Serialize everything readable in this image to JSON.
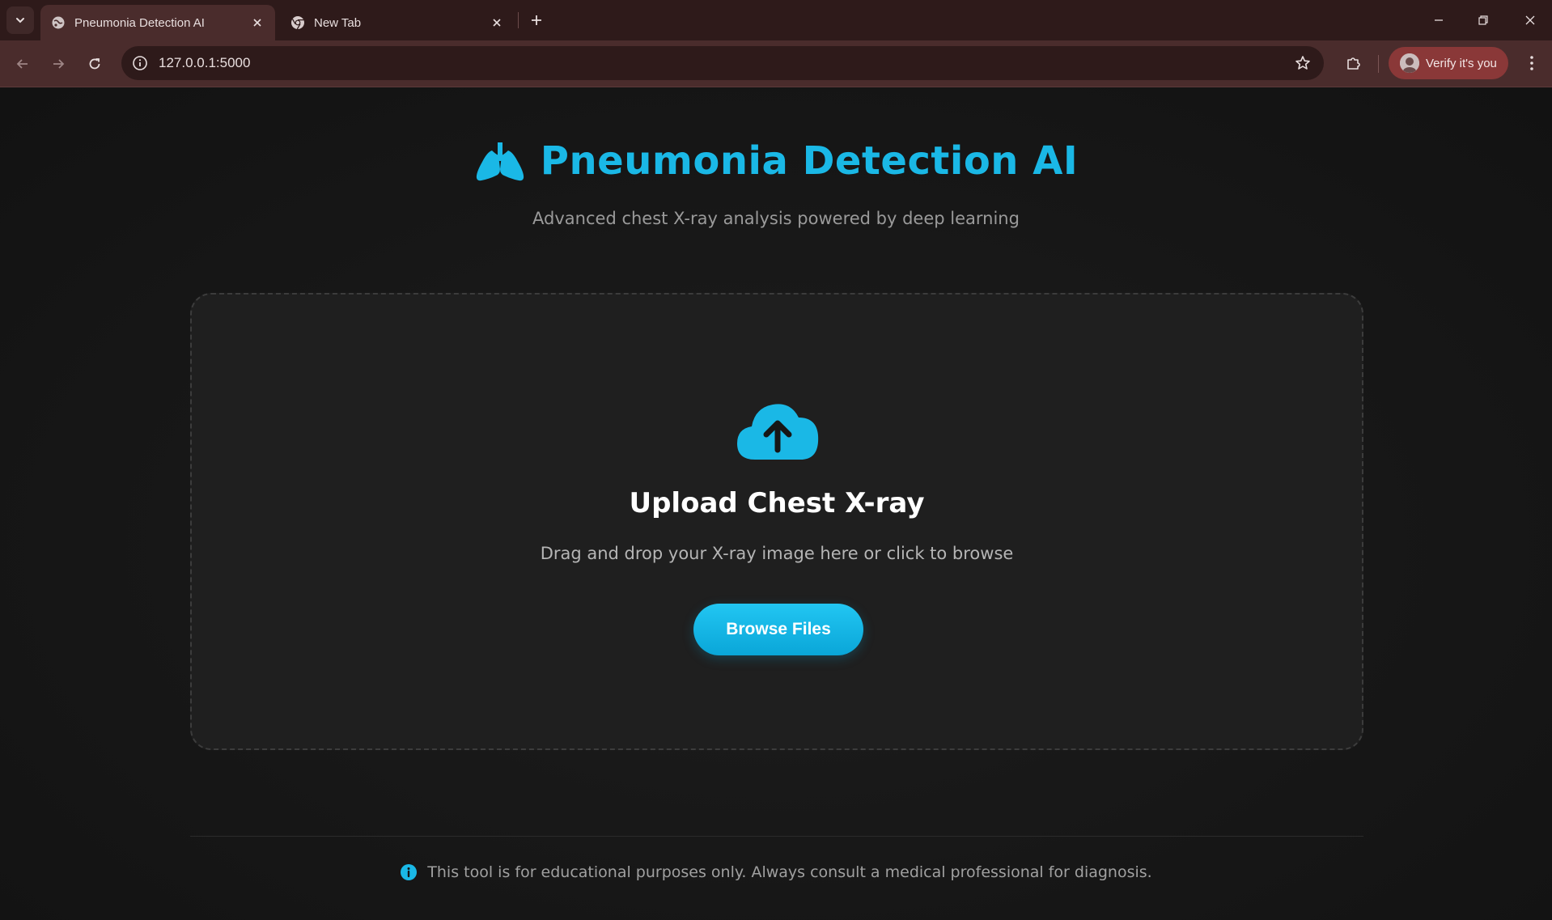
{
  "browser": {
    "tabs": [
      {
        "title": "Pneumonia Detection AI",
        "active": true,
        "favicon": "globe-icon"
      },
      {
        "title": "New Tab",
        "active": false,
        "favicon": "chrome-icon"
      }
    ],
    "url": "127.0.0.1:5000",
    "profile_label": "Verify it's you",
    "colors": {
      "frame": "#2e1a1a",
      "toolbar": "#4a2c2c",
      "profile_chip": "#8a3838"
    }
  },
  "page": {
    "title": "Pneumonia Detection AI",
    "subtitle": "Advanced chest X-ray analysis powered by deep learning",
    "upload": {
      "title": "Upload Chest X-ray",
      "description": "Drag and drop your X-ray image here or click to browse",
      "button_label": "Browse Files"
    },
    "footer_note": "This tool is for educational purposes only. Always consult a medical professional for diagnosis.",
    "colors": {
      "accent": "#1ab8e6",
      "background": "#141414",
      "card": "#1f1f1f"
    },
    "icons": {
      "logo": "lungs-icon",
      "upload": "cloud-upload-icon",
      "footer": "info-icon"
    }
  }
}
